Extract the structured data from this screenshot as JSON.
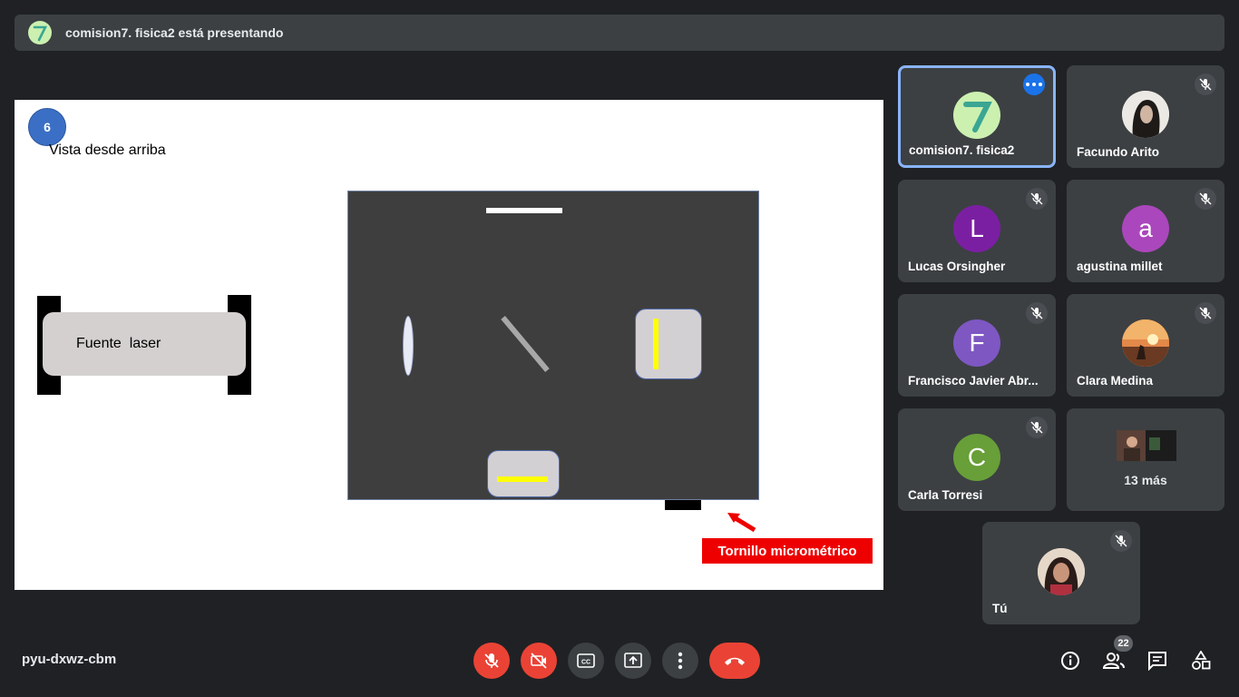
{
  "banner": {
    "text": "comision7. fisica2 está presentando",
    "avatar_icon": "seven-avatar"
  },
  "slide": {
    "number": "6",
    "subtitle": "Vista desde arriba",
    "laser_label": "Fuente  laser",
    "screw_label": "Tornillo micrométrico",
    "highlight_color": "#ffff00",
    "label_color": "#ee0000"
  },
  "participants": [
    {
      "name": "comision7. fisica2",
      "avatar": "7",
      "color": "#ccf0b0",
      "muted": false,
      "presenting": true
    },
    {
      "name": "Facundo Arito",
      "avatar": "photo",
      "color": "#ece9e4",
      "muted": true
    },
    {
      "name": "Lucas Orsingher",
      "avatar": "L",
      "color": "#7b1fa2",
      "muted": true
    },
    {
      "name": "agustina millet",
      "avatar": "a",
      "color": "#ab47bc",
      "muted": true
    },
    {
      "name": "Francisco Javier Abr...",
      "avatar": "F",
      "color": "#7e57c2",
      "muted": true
    },
    {
      "name": "Clara Medina",
      "avatar": "photo",
      "color": "#d4793a",
      "muted": true
    },
    {
      "name": "Carla Torresi",
      "avatar": "C",
      "color": "#689f38",
      "muted": true
    },
    {
      "name": "13 más",
      "avatar": "group"
    },
    {
      "name": "Tú",
      "avatar": "photo",
      "color": "#e6d8c8",
      "muted": true
    }
  ],
  "bottom_bar": {
    "meeting_code": "pyu-dxwz-cbm",
    "controls": [
      "mic-off",
      "camera-off",
      "captions",
      "present-now",
      "more-options",
      "leave-call"
    ],
    "participant_count": "22",
    "right_icons": [
      "info-icon",
      "people-icon",
      "chat-icon",
      "activities-icon"
    ]
  }
}
